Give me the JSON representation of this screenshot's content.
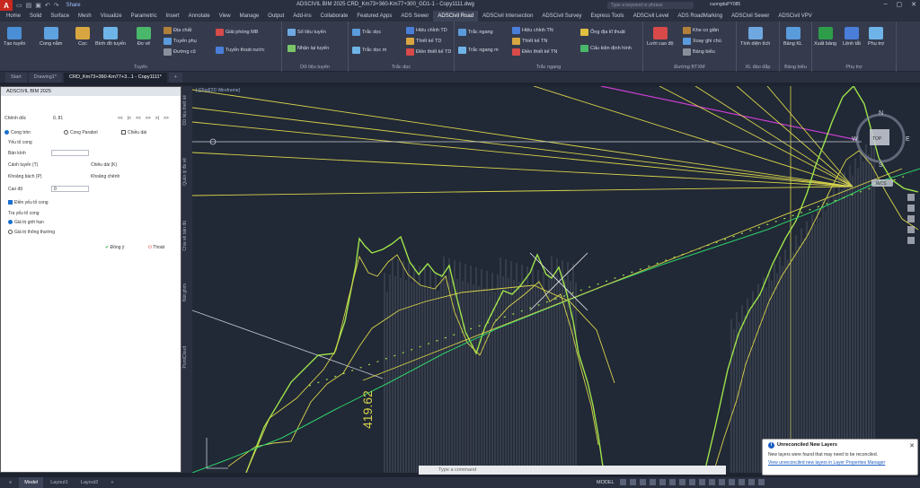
{
  "titlebar": {
    "app_letter": "A",
    "share": "Share",
    "title": "ADSCIVIL BIM 2025   CRD_Km73+360-Km77+300_GD1-1 - Copy1111.dwg",
    "search_placeholder": "Type a keyword or phrase",
    "user": "cuongduPY085",
    "minimize": "–",
    "maximize": "▢",
    "close": "✕"
  },
  "menu": [
    "Home",
    "Solid",
    "Surface",
    "Mesh",
    "Visualize",
    "Parametric",
    "Insert",
    "Annotate",
    "View",
    "Manage",
    "Output",
    "Add-ins",
    "Collaborate",
    "Featured Apps",
    "ADS Sewer",
    "ADSCivil Road",
    "ADSCivil Intersection",
    "ADSCivil Survey",
    "Express Tools",
    "ADSCivil Level",
    "ADS RoadMarking",
    "ADSCivil Sewer",
    "ADSCivil VPV"
  ],
  "menu_active": "ADSCivil Road",
  "ribbon": {
    "tuyen": {
      "label": "Tuyến",
      "buttons": [
        "Tạo tuyến",
        "Cong nằm",
        "Cọc",
        "Bình đồ tuyến",
        "Đo vẽ",
        "Địa chất",
        "Tuyến phụ",
        "Đường cũ",
        "Giải phóng MB",
        "Tuyến thoát nước"
      ]
    },
    "dulieu": {
      "label": "Dữ liệu tuyến",
      "buttons": [
        "Số liệu tuyến",
        "Nhận lại tuyến"
      ]
    },
    "tracdoc": {
      "label": "Trắc dọc",
      "buttons": [
        "Trắc dọc",
        "Hiệu chỉnh TD",
        "Thiết kế TD",
        "Trắc dọc m",
        "Điền thiết kế TD"
      ]
    },
    "tracngang": {
      "label": "Trắc ngang",
      "buttons": [
        "Trắc ngang",
        "Hiệu chỉnh TN",
        "Thiết kế TN",
        "Trắc ngang m",
        "Điền thiết kế TN",
        "Ống địa kĩ thuật",
        "Cấu kiện định hình"
      ]
    },
    "btxm": {
      "label": "Đường BTXM",
      "buttons": [
        "Lưới cao độ",
        "Khe co giãn",
        "Xoay ghi chú",
        "Bảng biểu"
      ]
    },
    "xldaodap": {
      "label": "XL đào đắp",
      "buttons": [
        "Tính diện tích"
      ]
    },
    "bangbieu": {
      "label": "Bảng biểu",
      "buttons": [
        "Bảng KL"
      ]
    },
    "phutro": {
      "label": "Phụ trợ",
      "buttons": [
        "Xuất bảng",
        "Lệnh tắt",
        "Phụ trợ"
      ]
    }
  },
  "filetabs": [
    "Start",
    "Drawing1*",
    "CRD_Km73+360-Km77+3...1 - Copy1111*"
  ],
  "filetab_active": 2,
  "panel": {
    "title": "ADSCIVIL BIM 2025",
    "chanh_doc_label": "Chênh dốc",
    "chanh_doc_value": "0, 81",
    "nav": [
      "<<",
      "|<",
      "<<",
      ">>",
      ">|",
      ">>"
    ],
    "options": [
      "Cong tròn",
      "Cong Parabol",
      "Chiều dài"
    ],
    "yeu_to_cong": "Yếu tố cong",
    "ban_kinh": "Bán kính",
    "canh_tuyen": "Cánh tuyến (T)",
    "chieu_dai_k": "Chiều dài (K)",
    "khoang_bach": "Khoảng bách (P)",
    "khoang_chanh": "Khoảng chênh",
    "cao_do_label": "Cao độ",
    "cao_do_value": "0",
    "dien_yeu_to": "Điền yếu tố cong",
    "tra_yeu_to": "Tra yếu tố cong",
    "gia_tri_gioi_han": "Giá trị giới hạn",
    "gia_tri_thong_thuong": "Giá trị thông thường",
    "dong_y": "Đồng ý",
    "thoat": "Thoát"
  },
  "vtabs": [
    "Dữ liệu thiết kế",
    "Quản lý đo vẽ",
    "Chia vẽ bản đồ",
    "Nút ghim",
    "PointCloud"
  ],
  "viewport": {
    "label": "[-][Top][2D Wireframe]",
    "dimension": "419.62",
    "compass": {
      "n": "N",
      "s": "S",
      "e": "E",
      "w": "W",
      "top": "TOP",
      "wcs": "WCS"
    }
  },
  "command_placeholder": "Type a command",
  "status": {
    "tabs": [
      "Model",
      "Layout1",
      "Layout2"
    ],
    "active": "Model",
    "mode": "MODEL"
  },
  "notification": {
    "title": "Unreconciled New Layers",
    "text": "New layers were found that may need to be reconciled.",
    "link": "View unreconciled new layers in Layer Properties Manager"
  },
  "colors": {
    "accent": "#2b5ebf",
    "terrain": "#9ee34a",
    "design": "#d8d44a",
    "alignment": "#2fd06a",
    "magenta": "#c83fd0"
  }
}
